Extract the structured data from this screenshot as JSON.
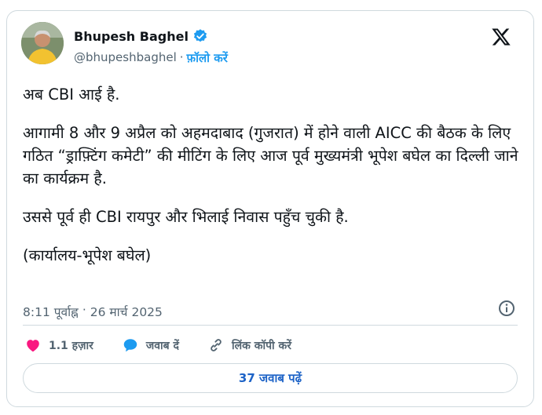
{
  "author": {
    "name": "Bhupesh Baghel",
    "handle": "@bhupeshbaghel",
    "separator": "·",
    "follow_label": "फ़ॉलो करें",
    "verified_color": "#1d9bf0"
  },
  "tweet": {
    "paragraphs": [
      "अब CBI आई है.",
      "आगामी 8 और 9 अप्रैल को अहमदाबाद (गुजरात) में होने वाली AICC की बैठक के लिए गठित “ड्राफ़्टिंग कमेटी” की मीटिंग के लिए आज पूर्व मुख्यमंत्री भूपेश बघेल का दिल्ली जाने का कार्यक्रम है.",
      "उससे पूर्व ही CBI रायपुर और भिलाई निवास पहुँच चुकी है.",
      "(कार्यालय-भूपेश बघेल)"
    ],
    "time": "8:11 पूर्वाह्न",
    "dot": "·",
    "date": "26 मार्च 2025"
  },
  "actions": {
    "likes": "1.1 हज़ार",
    "reply": "जवाब दें",
    "copy_link": "लिंक कॉपी करें"
  },
  "read_replies": "37 जवाब पढ़ें",
  "colors": {
    "like_heart": "#f91880",
    "reply_bubble": "#1d9bf0",
    "link_text": "#1d63c7"
  },
  "icons": [
    "x-logo-icon",
    "verified-badge-icon",
    "info-icon",
    "heart-icon",
    "reply-bubble-icon",
    "link-icon"
  ]
}
